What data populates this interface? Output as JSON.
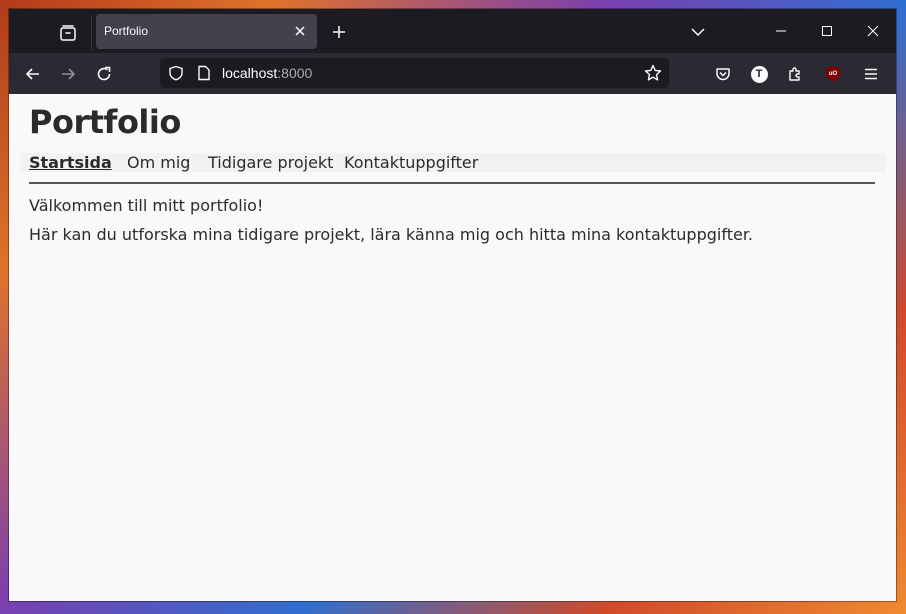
{
  "browser": {
    "tab": {
      "title": "Portfolio"
    },
    "url": {
      "host": "localhost",
      "port": ":8000"
    },
    "profile_initial": "T",
    "ublock_label": "uO",
    "icons": [
      "tab-overview-icon",
      "close-icon",
      "plus-icon",
      "chevron-down-icon",
      "minimize-icon",
      "maximize-icon",
      "close-icon",
      "back-arrow-icon",
      "forward-arrow-icon",
      "reload-icon",
      "shield-icon",
      "page-icon",
      "star-icon",
      "pocket-icon",
      "puzzle-icon",
      "hamburger-menu-icon"
    ]
  },
  "page": {
    "title": "Portfolio",
    "nav": [
      {
        "label": "Startsida",
        "active": true
      },
      {
        "label": "Om mig",
        "active": false
      },
      {
        "label": "Tidigare projekt",
        "active": false
      },
      {
        "label": "Kontaktuppgifter",
        "active": false
      }
    ],
    "welcome": "Välkommen till mitt portfolio!",
    "intro": "Här kan du utforska mina tidigare projekt, lära känna mig och hitta mina kontaktuppgifter."
  }
}
